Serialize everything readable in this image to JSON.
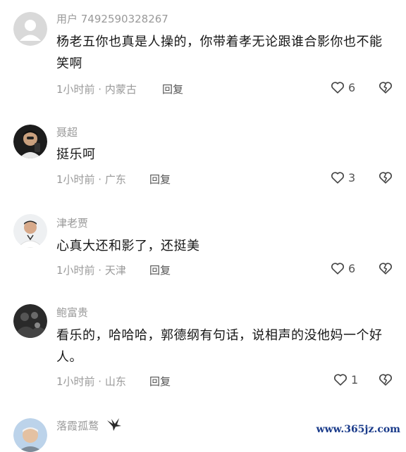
{
  "comments": [
    {
      "username": "用户 7492590328267",
      "text": "杨老五你也真是人操的，你带着孝无论跟谁合影你也不能笑啊",
      "time": "1小时前 · 内蒙古",
      "reply": "回复",
      "likes": "6",
      "avatar_icon": "default-user-avatar"
    },
    {
      "username": "聂超",
      "text": "挺乐呵",
      "time": "1小时前 · 广东",
      "reply": "回复",
      "likes": "3",
      "avatar_icon": "selfie-avatar"
    },
    {
      "username": "津老贾",
      "text": "心真大还和影了，还挺美",
      "time": "1小时前 · 天津",
      "reply": "回复",
      "likes": "6",
      "avatar_icon": "portrait-avatar"
    },
    {
      "username": "鲍富贵",
      "text": "看乐的，哈哈哈，郭德纲有句话，说相声的没他妈一个好人。",
      "time": "1小时前 · 山东",
      "reply": "回复",
      "likes": "1",
      "avatar_icon": "dark-photo-avatar"
    },
    {
      "username": "落霞孤鹜",
      "avatar_icon": "old-man-avatar"
    }
  ],
  "watermark": "www.365jz.com",
  "colors": {
    "text": "#161616",
    "meta": "#9a9a9a",
    "icon": "#444444"
  }
}
